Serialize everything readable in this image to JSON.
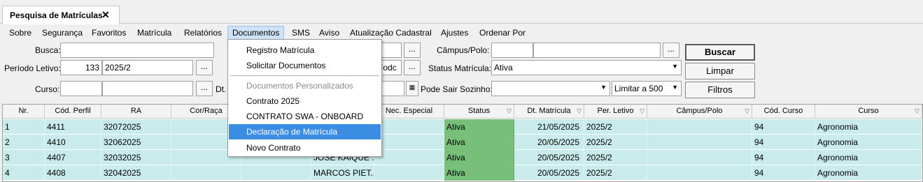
{
  "tab": {
    "title": "Pesquisa de Matrículas",
    "close": "✕"
  },
  "menu": [
    {
      "label": "Sobre"
    },
    {
      "label": "Segurança"
    },
    {
      "label": "Favoritos"
    },
    {
      "label": "Matrícula"
    },
    {
      "label": "Relatórios"
    },
    {
      "label": "Documentos"
    },
    {
      "label": "SMS"
    },
    {
      "label": "Aviso"
    },
    {
      "label": "Atualização Cadastral"
    },
    {
      "label": "Ajustes"
    },
    {
      "label": "Ordenar Por"
    }
  ],
  "form": {
    "busca_label": "Busca:",
    "busca_value": "",
    "periodo_label": "Período Letivo:",
    "periodo_code": "133",
    "periodo_value": "2025/2",
    "curso_label": "Curso:",
    "curso_code": "",
    "curso_value": "",
    "dt_label": "Dt.",
    "mid_field_1": "",
    "mid_field_2": "íodc",
    "mid_field_3": "",
    "campus_label": "Câmpus/Polo:",
    "campus_code": "",
    "campus_value": "",
    "status_label": "Status Matrícula:",
    "status_value": "Ativa",
    "pode_sair_label": "Pode Sair Sozinho:",
    "pode_sair_value": "",
    "limit_value": "Limitar a 500",
    "dots": "...",
    "calendar_icon": "calendar-icon"
  },
  "buttons": {
    "buscar": "Buscar",
    "limpar": "Limpar",
    "filtros": "Filtros"
  },
  "grid": {
    "columns": [
      "Nr.",
      "Cód. Perfil",
      "RA",
      "Cor/Raça",
      "",
      "",
      "Nec. Especial",
      "Status",
      "Dt. Matrícula",
      "Per. Letivo",
      "Câmpus/Polo",
      "Cód. Curso",
      "Curso"
    ],
    "rows": [
      {
        "nr": "1",
        "perfil": "4411",
        "ra": "32072025",
        "nome": "",
        "status": "Ativa",
        "dt": "21/05/2025",
        "per": "2025/2",
        "cod_curso": "94",
        "curso": "Agronomia",
        "extra": "A"
      },
      {
        "nr": "2",
        "perfil": "4410",
        "ra": "32062025",
        "nome": "",
        "status": "Ativa",
        "dt": "20/05/2025",
        "per": "2025/2",
        "cod_curso": "94",
        "curso": "Agronomia",
        "extra": "A"
      },
      {
        "nr": "3",
        "perfil": "4407",
        "ra": "32032025",
        "nome": "JOSE KAIQUE ...",
        "status": "Ativa",
        "dt": "20/05/2025",
        "per": "2025/2",
        "cod_curso": "94",
        "curso": "Agronomia",
        "extra": "A"
      },
      {
        "nr": "4",
        "perfil": "4408",
        "ra": "32042025",
        "nome": "MARCOS PIET...",
        "status": "Ativa",
        "dt": "20/05/2025",
        "per": "2025/2",
        "cod_curso": "94",
        "curso": "Agronomia",
        "extra": "A"
      }
    ]
  },
  "dropdown": {
    "items": [
      "Registro Matrícula",
      "Solicitar Documentos",
      "Documentos Personalizados",
      "Contrato 2025",
      "CONTRATO SWA - ONBOARD",
      "Declaração de Matrícula",
      "Novo Contrato"
    ]
  },
  "colors": {
    "row_bg": "#c9ebeb",
    "status_bg": "#78c07a",
    "highlight": "#3b8ce3"
  }
}
